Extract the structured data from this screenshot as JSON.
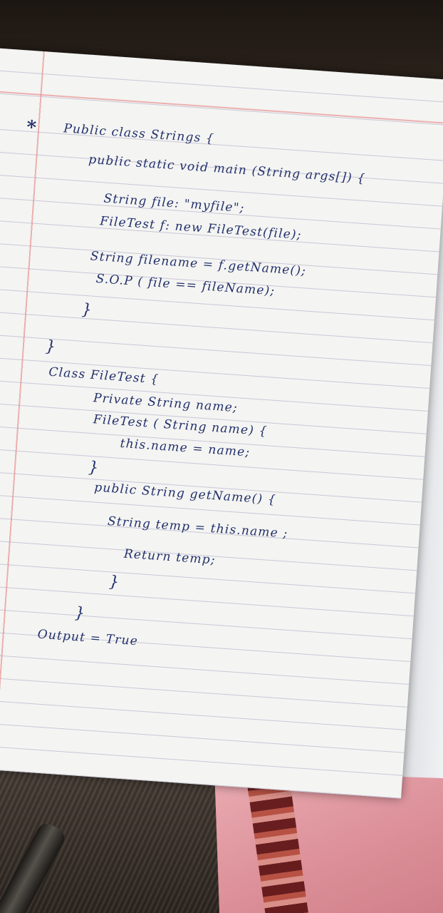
{
  "notebook": {
    "bullet": "*",
    "lines": [
      "Public class Strings {",
      "public static void main (String args[]) {",
      "String file: \"myfile\";",
      "FileTest f: new FileTest(file);",
      "String filename = f.getName();",
      "S.O.P ( file == fileName);",
      "}",
      "}",
      "Class FileTest {",
      "Private String name;",
      "FileTest ( String name) {",
      "this.name = name;",
      "}",
      "public String getName() {",
      "String temp = this.name ;",
      "Return temp;",
      "}",
      "}",
      "Output = True"
    ]
  }
}
